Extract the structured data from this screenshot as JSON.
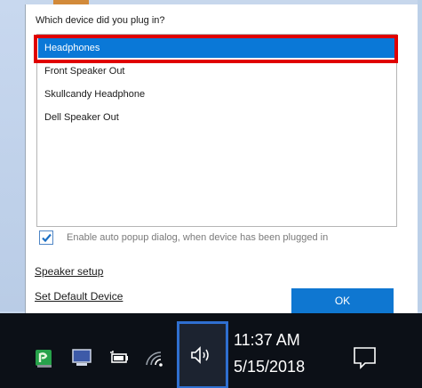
{
  "dialog": {
    "title": "Which device did you plug in?",
    "devices": [
      {
        "label": "Headphones",
        "selected": true
      },
      {
        "label": "Front Speaker Out",
        "selected": false
      },
      {
        "label": "Skullcandy Headphone",
        "selected": false
      },
      {
        "label": "Dell Speaker Out",
        "selected": false
      }
    ],
    "auto_popup": {
      "label": "Enable auto popup dialog, when device has been plugged in",
      "checked": true
    },
    "speaker_setup_label": "Speaker setup",
    "set_default_label": "Set Default Device",
    "ok_label": "OK"
  },
  "taskbar": {
    "icons": [
      "realtek-audio-icon",
      "display-icon",
      "battery-icon",
      "wifi-icon",
      "speaker-icon",
      "action-center-icon"
    ],
    "time": "11:37 AM",
    "date": "5/15/2018"
  },
  "colors": {
    "selection": "#0a78d7",
    "ok_button": "#0f77d1",
    "highlight": "#e00000",
    "volume_highlight": "#2f6fd0",
    "taskbar": "#0c1017"
  }
}
